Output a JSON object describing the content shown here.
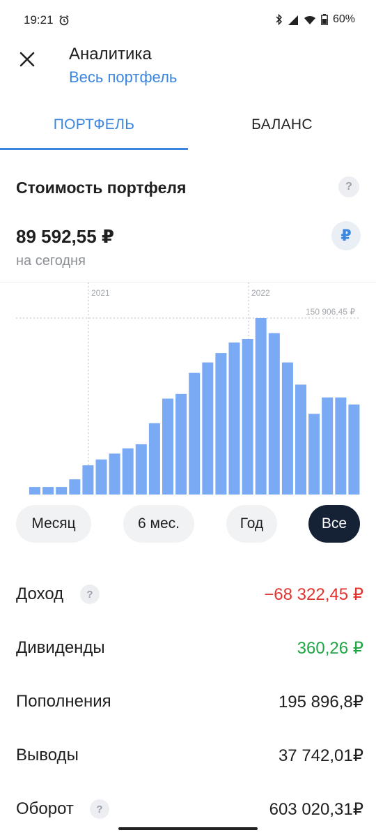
{
  "status_bar": {
    "time": "19:21",
    "battery": "60%"
  },
  "header": {
    "title": "Аналитика",
    "subtitle": "Весь портфель"
  },
  "tabs": [
    {
      "label": "ПОРТФЕЛЬ",
      "active": true
    },
    {
      "label": "БАЛАНС",
      "active": false
    }
  ],
  "portfolio": {
    "section_title": "Стоимость портфеля",
    "help_symbol": "?",
    "value": "89 592,55 ₽",
    "value_caption": "на сегодня",
    "currency_symbol": "₽"
  },
  "chart_data": {
    "type": "bar",
    "max_label": "150 906,45 ₽",
    "max_value": 150906.45,
    "year_markers": [
      "2021",
      "2022"
    ],
    "values": [
      6500,
      6500,
      6500,
      13000,
      25000,
      30000,
      35000,
      39500,
      43000,
      61000,
      82000,
      86000,
      104000,
      113000,
      121000,
      130000,
      133000,
      150906.45,
      138000,
      113000,
      94000,
      69000,
      83000,
      83000,
      77000
    ],
    "bar_color": "#7aaaf4",
    "grid": false
  },
  "periods": [
    {
      "label": "Месяц",
      "active": false
    },
    {
      "label": "6 мес.",
      "active": false
    },
    {
      "label": "Год",
      "active": false
    },
    {
      "label": "Все",
      "active": true
    }
  ],
  "stats": [
    {
      "label": "Доход",
      "value": "−68 322,45 ₽",
      "tone": "negative",
      "has_help": true
    },
    {
      "label": "Дивиденды",
      "value": "360,26 ₽",
      "tone": "positive",
      "has_help": false
    },
    {
      "label": "Пополнения",
      "value": "195 896,8₽",
      "tone": "neutral",
      "has_help": false
    },
    {
      "label": "Выводы",
      "value": "37 742,01₽",
      "tone": "neutral",
      "has_help": false
    },
    {
      "label": "Оборот",
      "value": "603 020,31₽",
      "tone": "neutral",
      "has_help": true
    }
  ],
  "colors": {
    "accent": "#3b86e0",
    "negative": "#e0342f",
    "positive": "#21a646",
    "active_chip": "#152235"
  }
}
